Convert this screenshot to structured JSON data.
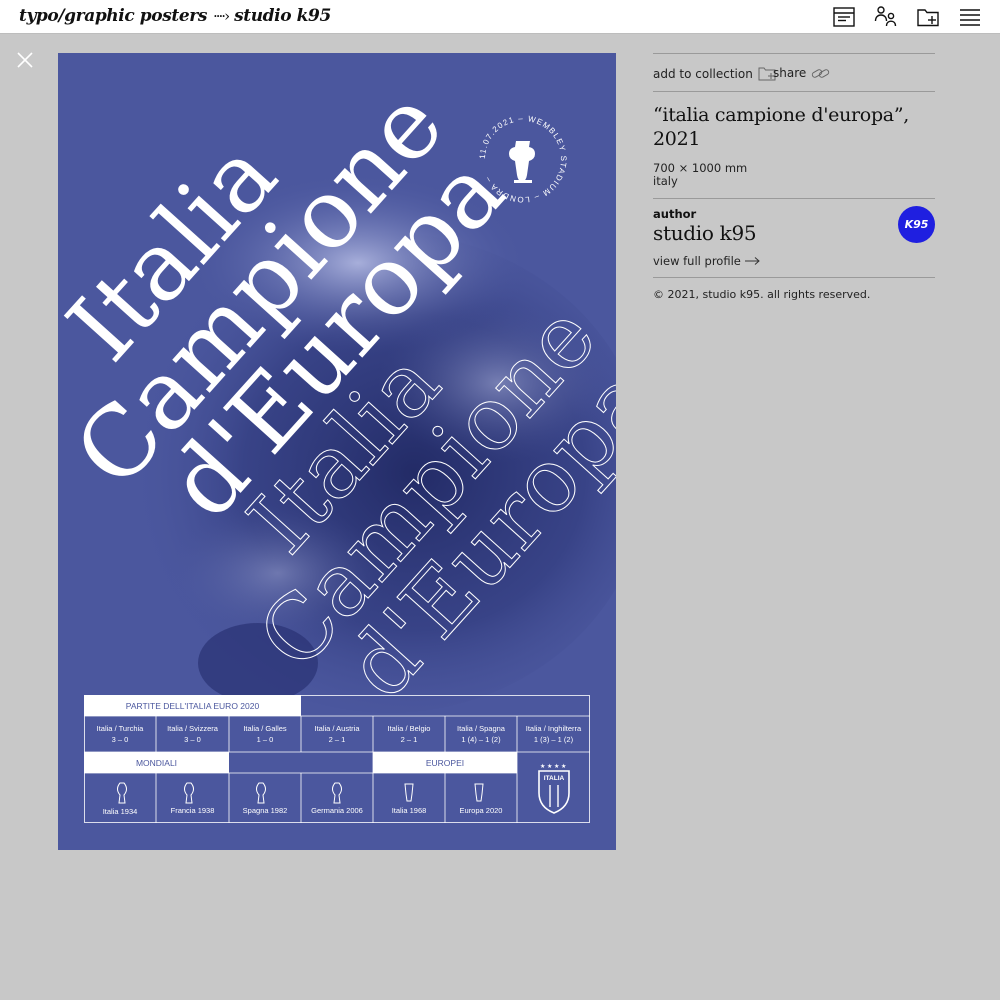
{
  "header": {
    "breadcrumb_root": "typo/graphic posters",
    "breadcrumb_current": "studio k95",
    "icons": [
      "card-view-icon",
      "people-icon",
      "folder-add-icon",
      "menu-icon"
    ]
  },
  "poster": {
    "headline": [
      "Italia",
      "Campione",
      "d'Europa"
    ],
    "seal_text": "11.07.2021 – WEMBLEY STADIUM – LONDRA –",
    "table": {
      "matches_header": "PARTITE DELL'ITALIA EURO 2020",
      "matches": [
        {
          "teams": "Italia / Turchia",
          "score": "3 – 0"
        },
        {
          "teams": "Italia / Svizzera",
          "score": "3 – 0"
        },
        {
          "teams": "Italia / Galles",
          "score": "1 – 0"
        },
        {
          "teams": "Italia / Austria",
          "score": "2 – 1"
        },
        {
          "teams": "Italia / Belgio",
          "score": "2 – 1"
        },
        {
          "teams": "Italia / Spagna",
          "score": "1 (4) – 1 (2)"
        },
        {
          "teams": "Italia / Inghilterra",
          "score": "1 (3) – 1 (2)"
        }
      ],
      "mondiali_header": "MONDIALI",
      "europei_header": "EUROPEI",
      "mondiali": [
        "Italia 1934",
        "Francia 1938",
        "Spagna 1982",
        "Germania 2006"
      ],
      "europei": [
        "Italia 1968",
        "Europa 2020"
      ],
      "crest_text": "ITALIA"
    }
  },
  "info": {
    "add_to_collection": "add to collection",
    "share": "share",
    "title": "“italia campione d'europa”, 2021",
    "dimensions": "700 × 1000 mm",
    "country": "italy",
    "author_label": "author",
    "author_name": "studio k95",
    "view_profile": "view full profile",
    "avatar_text": "K95",
    "copyright": "© 2021, studio k95. all rights reserved."
  },
  "colors": {
    "poster_bg": "#4b579e",
    "avatar_bg": "#1f1fe0",
    "page_bg": "#c8c8c8"
  }
}
